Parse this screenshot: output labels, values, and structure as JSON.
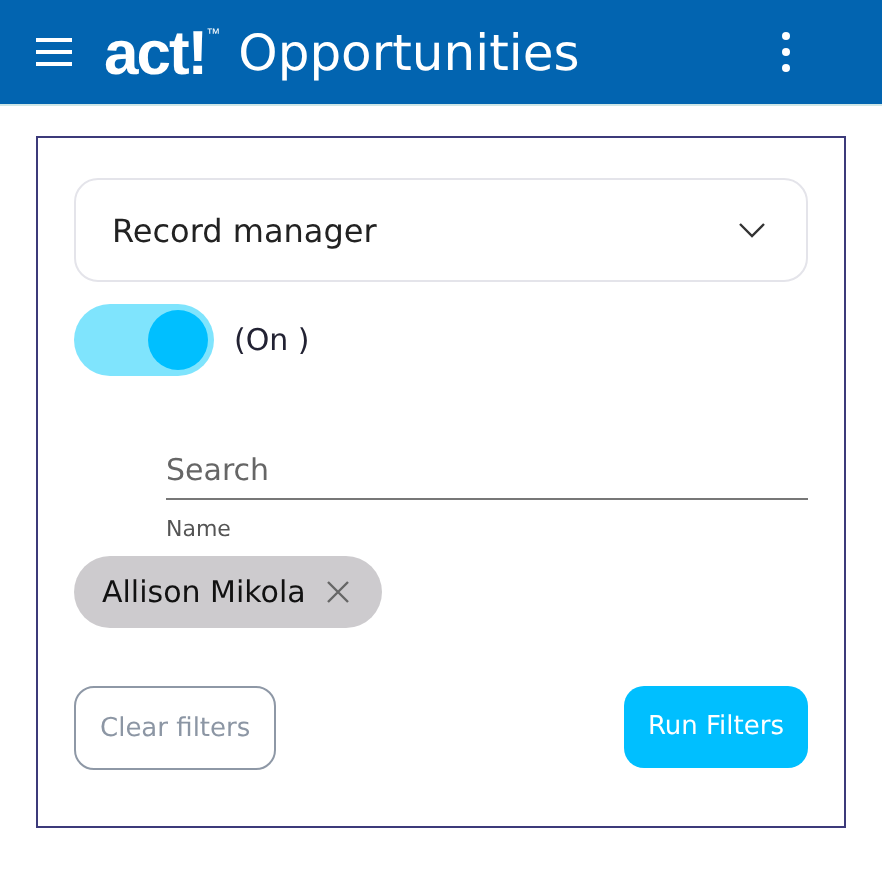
{
  "app_bar": {
    "logo": "act!$^{™}$",
    "title": "Opportunities"
  },
  "filter_panel": {
    "dropdown": {
      "value": "Record manager",
      "expanded": false
    },
    "toggle": {
      "on": true,
      "label": "(On )"
    },
    "search": {
      "placeholder": "Search",
      "helper": "Name"
    },
    "chips": [
      {
        "label": "Allison Mikola"
      }
    ],
    "buttons": [
      {
        "kind": "outline",
        "label": "Clear filters"
      },
      {
        "kind": "primary",
        "label": "Run Filters"
      }
    ]
  }
}
